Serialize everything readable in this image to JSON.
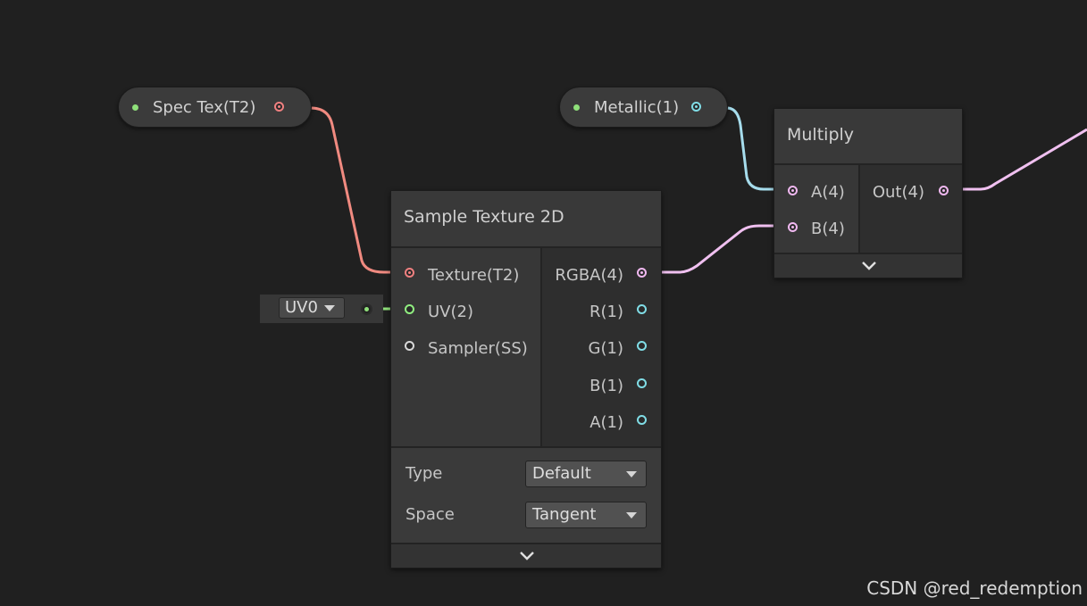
{
  "properties": {
    "spec_tex": {
      "label": "Spec Tex(T2)"
    },
    "metallic": {
      "label": "Metallic(1)"
    }
  },
  "sample_texture": {
    "title": "Sample Texture 2D",
    "inputs": [
      "Texture(T2)",
      "UV(2)",
      "Sampler(SS)"
    ],
    "outputs": [
      "RGBA(4)",
      "R(1)",
      "G(1)",
      "B(1)",
      "A(1)"
    ],
    "type_label": "Type",
    "type_value": "Default",
    "space_label": "Space",
    "space_value": "Tangent"
  },
  "uv_node": {
    "value": "UV0"
  },
  "multiply": {
    "title": "Multiply",
    "inputs": [
      "A(4)",
      "B(4)"
    ],
    "output": "Out(4)"
  },
  "watermark": "CSDN @red_redemption",
  "colors": {
    "background": "#202020",
    "texture_port": "#f08080",
    "vector4_port": "#f0b8f0",
    "vector2_port": "#90ee80",
    "float_port": "#80dde6",
    "sampler_port": "#d8d8d8"
  }
}
